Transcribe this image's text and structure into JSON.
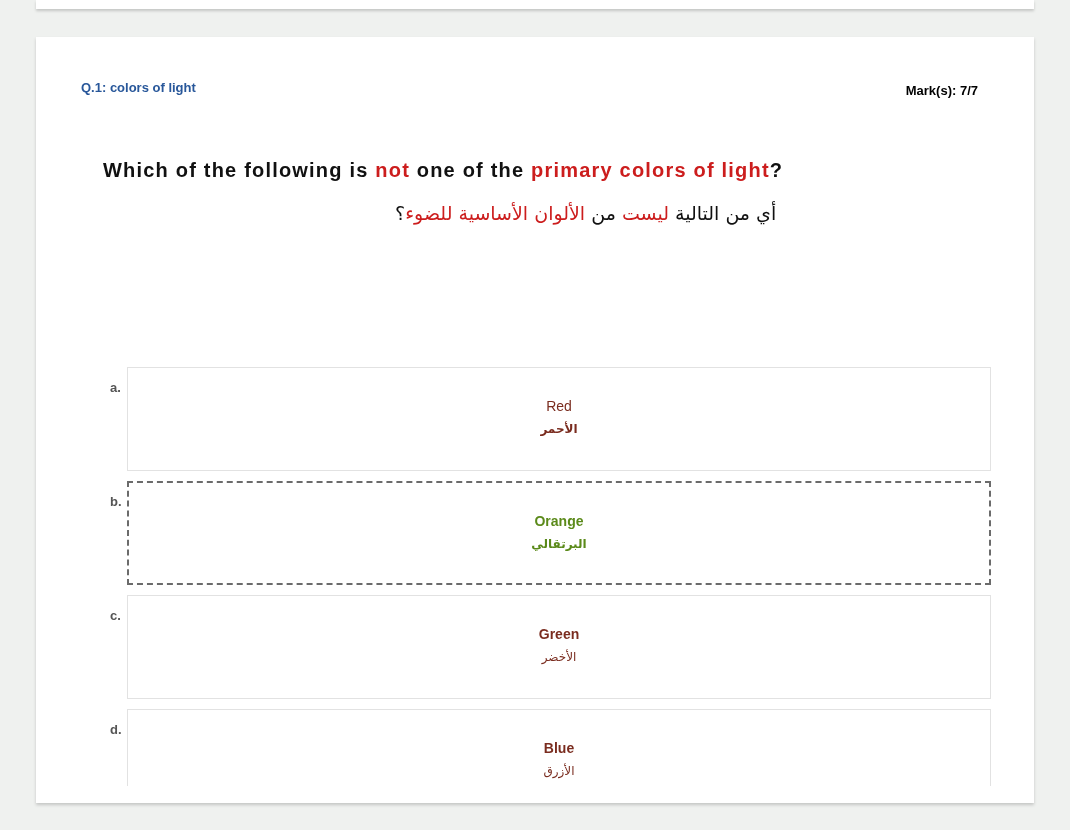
{
  "question_header": {
    "title": "Q.1: colors of light",
    "marks": "Mark(s): 7/7"
  },
  "question": {
    "english": {
      "lead": {
        "text": "Which of the following is ",
        "highlight": false
      },
      "keyword": {
        "text": "not",
        "highlight": true
      },
      "middle": {
        "text": " one of the ",
        "highlight": false
      },
      "phrase": {
        "text": "primary colors of light",
        "highlight": true
      },
      "end": {
        "text": "?",
        "highlight": false
      }
    },
    "arabic": {
      "lead": {
        "text": "أي من التالية ",
        "highlight": false
      },
      "keyword": {
        "text": "ليست",
        "highlight": true
      },
      "middle": {
        "text": " من ",
        "highlight": false
      },
      "phrase": {
        "text": "الألوان الأساسية للضوء",
        "highlight": true
      },
      "end": {
        "text": "؟",
        "highlight": false
      }
    }
  },
  "options": [
    {
      "letter": "a.",
      "selected": false,
      "lines": [
        {
          "text": "Red",
          "bold": false
        },
        {
          "text": "الأحمر",
          "bold": true
        }
      ]
    },
    {
      "letter": "b.",
      "selected": true,
      "lines": [
        {
          "text": "Orange",
          "bold": true
        },
        {
          "text": "البرتقالي",
          "bold": true
        }
      ]
    },
    {
      "letter": "c.",
      "selected": false,
      "lines": [
        {
          "text": "Green",
          "bold": true
        },
        {
          "text": "الأخضر",
          "bold": false
        }
      ]
    },
    {
      "letter": "d.",
      "selected": false,
      "lines": [
        {
          "text": "Blue",
          "bold": true
        },
        {
          "text": "الأزرق",
          "bold": false
        }
      ]
    }
  ]
}
